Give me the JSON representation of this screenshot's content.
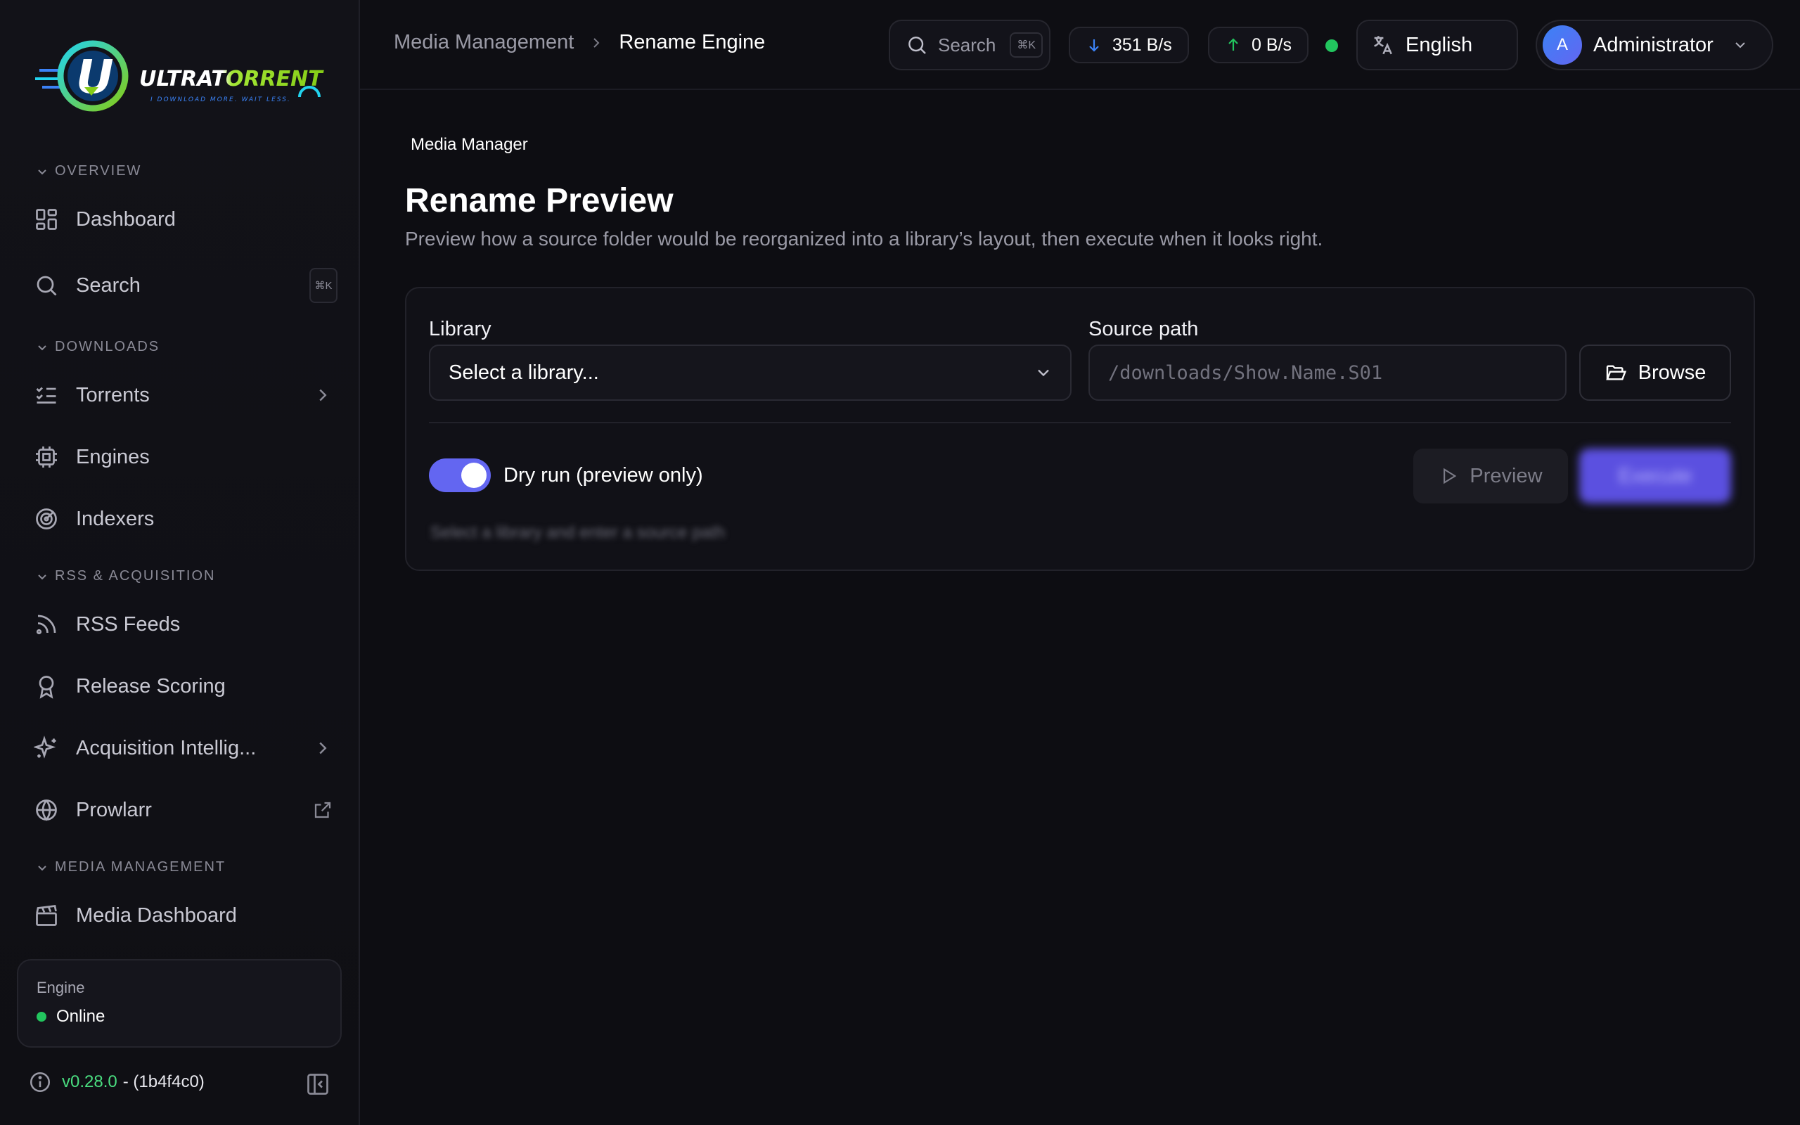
{
  "brand": {
    "name": "ULTRATORRENT",
    "tagline": "I DOWNLOAD MORE. WAIT LESS."
  },
  "sidebar": {
    "sections": {
      "overview": "OVERVIEW",
      "downloads": "DOWNLOADS",
      "rss": "RSS & ACQUISITION",
      "media": "MEDIA MANAGEMENT"
    },
    "items": {
      "dashboard": "Dashboard",
      "search": "Search",
      "search_kbd": "⌘K",
      "torrents": "Torrents",
      "engines": "Engines",
      "indexers": "Indexers",
      "rss_feeds": "RSS Feeds",
      "release_scoring": "Release Scoring",
      "acquisition": "Acquisition Intellig...",
      "prowlarr": "Prowlarr",
      "media_dashboard": "Media Dashboard"
    },
    "engine": {
      "label": "Engine",
      "status": "Online"
    },
    "version": "v0.28.0",
    "build": "- (1b4f4c0)"
  },
  "topbar": {
    "breadcrumb": [
      "Media Management",
      "Rename Engine"
    ],
    "search_label": "Search",
    "search_kbd": "⌘K",
    "download_rate": "351 B/s",
    "upload_rate": "0 B/s",
    "language": "English",
    "user_initial": "A",
    "user_name": "Administrator"
  },
  "main": {
    "subhead": "Media Manager",
    "title": "Rename Preview",
    "description": "Preview how a source folder would be reorganized into a library’s layout, then execute when it looks right.",
    "library_label": "Library",
    "library_value": "Select a library...",
    "source_label": "Source path",
    "source_placeholder": "/downloads/Show.Name.S01",
    "browse_label": "Browse",
    "dry_run_label": "Dry run (preview only)",
    "preview_label": "Preview",
    "execute_label": "Execute",
    "hint": "Select a library and enter a source path"
  },
  "colors": {
    "accent": "#6366f1",
    "online": "#22c55e",
    "version": "#4ade80"
  }
}
